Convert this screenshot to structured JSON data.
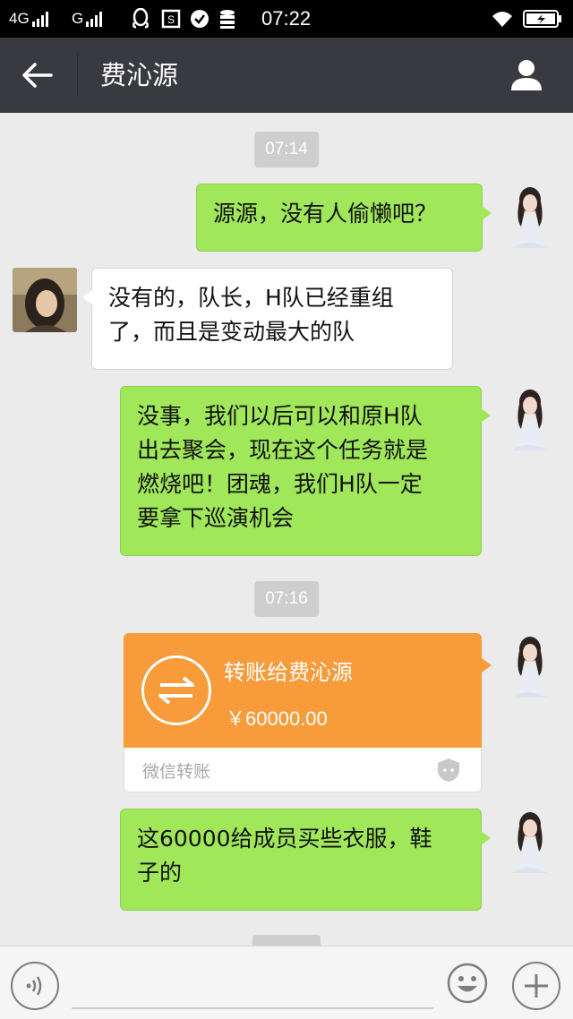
{
  "status_bar": {
    "network1": "4G",
    "network2": "G",
    "time": "07:22",
    "icons": [
      "signal-icon",
      "qq-icon",
      "sim-icon",
      "check-icon",
      "database-icon",
      "wifi-icon",
      "battery-charging-icon"
    ]
  },
  "nav": {
    "title": "费沁源",
    "back_icon": "back-arrow-icon",
    "profile_icon": "person-icon"
  },
  "chat": {
    "timestamps": [
      "07:14",
      "07:16"
    ],
    "messages": [
      {
        "side": "right",
        "text": "源源，没有人偷懒吧？"
      },
      {
        "side": "left",
        "lines": [
          "没有的，队长，H队已经重组",
          "了，而且是变动最大的队"
        ]
      },
      {
        "side": "right",
        "lines": [
          "没事，我们以后可以和原H队",
          "出去聚会，现在这个任务就是",
          "燃烧吧！团魂，我们H队一定",
          "要拿下巡演机会"
        ]
      },
      {
        "side": "right",
        "lines": [
          "这60000给成员买些衣服，鞋",
          "子的"
        ]
      }
    ],
    "transfer": {
      "title": "转账给费沁源",
      "amount": "￥60000.00",
      "footer_label": "微信转账",
      "accent_color": "#f89b3a"
    }
  },
  "input_bar": {
    "placeholder": "",
    "voice_icon": "voice-icon",
    "emoji_icon": "emoji-icon",
    "plus_icon": "plus-icon"
  },
  "colors": {
    "my_bubble": "#a0e75a",
    "other_bubble": "#ffffff",
    "nav_bg": "#393a3f",
    "chat_bg": "#ebebeb"
  }
}
